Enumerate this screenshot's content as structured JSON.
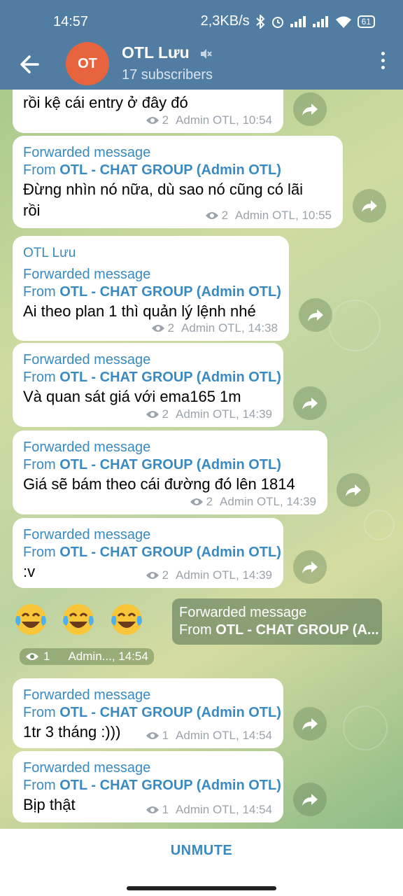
{
  "status": {
    "time": "14:57",
    "net_speed": "2,3KB/s",
    "battery": "61"
  },
  "header": {
    "avatar_initials": "OT",
    "avatar_color": "#e8643e",
    "title": "OTL Lưu",
    "subtitle": "17 subscribers",
    "muted_icon": "speaker-muted-icon"
  },
  "messages": [
    {
      "text": "rồi kệ cái entry ở đây đó",
      "views": "2",
      "meta": "Admin OTL, 10:54"
    },
    {
      "fwd_label": "Forwarded message",
      "from_prefix": "From",
      "from_name": "OTL - CHAT GROUP (Admin OTL)",
      "text_line1": "Đừng nhìn nó nữa, dù sao nó cũng có lãi",
      "text_line2": "rồi",
      "views": "2",
      "meta": "Admin OTL, 10:55"
    },
    {
      "sender": "OTL Lưu",
      "fwd_label": "Forwarded message",
      "from_prefix": "From",
      "from_name": "OTL - CHAT GROUP (Admin OTL)",
      "text": "Ai theo plan 1 thì quản lý lệnh nhé",
      "views": "2",
      "meta": "Admin OTL, 14:38"
    },
    {
      "fwd_label": "Forwarded message",
      "from_prefix": "From",
      "from_name": "OTL - CHAT GROUP (Admin OTL)",
      "text": "Và quan sát giá với ema165 1m",
      "views": "2",
      "meta": "Admin OTL, 14:39"
    },
    {
      "fwd_label": "Forwarded message",
      "from_prefix": "From",
      "from_name": "OTL - CHAT GROUP (Admin OTL)",
      "text": "Giá sẽ bám theo cái đường đó lên 1814",
      "views": "2",
      "meta": "Admin OTL, 14:39"
    },
    {
      "fwd_label": "Forwarded message",
      "from_prefix": "From",
      "from_name": "OTL - CHAT GROUP (Admin OTL)",
      "text": ":v",
      "views": "2",
      "meta": "Admin OTL, 14:39"
    },
    {
      "emojis": [
        "😂",
        "😂",
        "😂"
      ],
      "fwd_label": "Forwarded message",
      "from_prefix": "From",
      "from_name": "OTL - CHAT GROUP (A...",
      "views": "1",
      "meta": "Admin..., 14:54"
    },
    {
      "fwd_label": "Forwarded message",
      "from_prefix": "From",
      "from_name": "OTL - CHAT GROUP (Admin OTL)",
      "text": "1tr 3 tháng :)))",
      "views": "1",
      "meta": "Admin OTL, 14:54"
    },
    {
      "fwd_label": "Forwarded message",
      "from_prefix": "From",
      "from_name": "OTL - CHAT GROUP (Admin OTL)",
      "text": "Bịp thật",
      "views": "1",
      "meta": "Admin OTL, 14:54"
    }
  ],
  "footer": {
    "unmute_label": "UNMUTE"
  },
  "colors": {
    "header": "#517da2",
    "link": "#3a8ac2"
  }
}
